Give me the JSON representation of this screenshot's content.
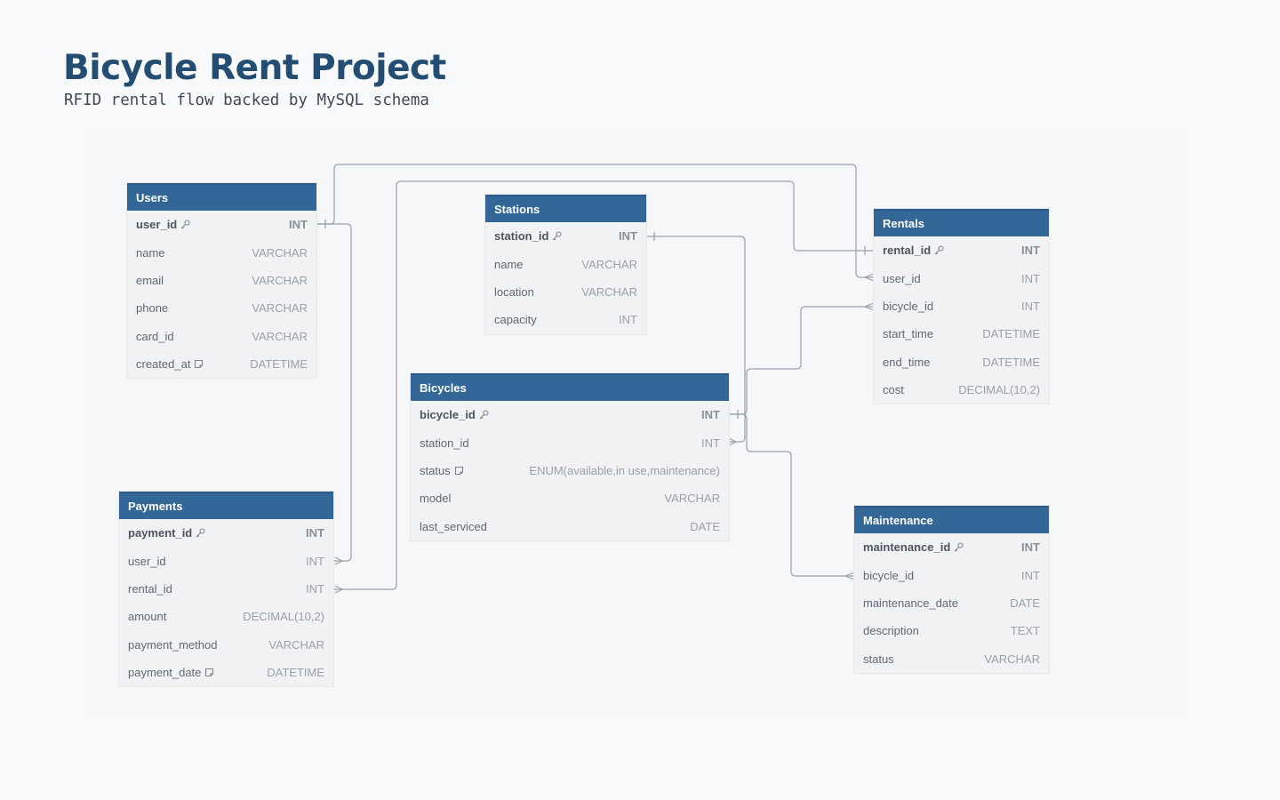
{
  "header": {
    "title": "Bicycle Rent Project",
    "subtitle": "RFID rental flow backed by MySQL schema"
  },
  "colors": {
    "header_bg": "#336798",
    "title": "#234d73",
    "connector": "#9aa1aa"
  },
  "tables": {
    "users": {
      "name": "Users",
      "fields": [
        {
          "name": "user_id",
          "type": "INT",
          "icon": "key-icon"
        },
        {
          "name": "name",
          "type": "VARCHAR"
        },
        {
          "name": "email",
          "type": "VARCHAR"
        },
        {
          "name": "phone",
          "type": "VARCHAR"
        },
        {
          "name": "card_id",
          "type": "VARCHAR"
        },
        {
          "name": "created_at",
          "type": "DATETIME",
          "icon": "note-icon"
        }
      ]
    },
    "stations": {
      "name": "Stations",
      "fields": [
        {
          "name": "station_id",
          "type": "INT",
          "icon": "key-icon"
        },
        {
          "name": "name",
          "type": "VARCHAR"
        },
        {
          "name": "location",
          "type": "VARCHAR"
        },
        {
          "name": "capacity",
          "type": "INT"
        }
      ]
    },
    "rentals": {
      "name": "Rentals",
      "fields": [
        {
          "name": "rental_id",
          "type": "INT",
          "icon": "key-icon"
        },
        {
          "name": "user_id",
          "type": "INT"
        },
        {
          "name": "bicycle_id",
          "type": "INT"
        },
        {
          "name": "start_time",
          "type": "DATETIME"
        },
        {
          "name": "end_time",
          "type": "DATETIME"
        },
        {
          "name": "cost",
          "type": "DECIMAL(10,2)"
        }
      ]
    },
    "bicycles": {
      "name": "Bicycles",
      "fields": [
        {
          "name": "bicycle_id",
          "type": "INT",
          "icon": "key-icon"
        },
        {
          "name": "station_id",
          "type": "INT"
        },
        {
          "name": "status",
          "type": "ENUM(available,in use,maintenance)",
          "icon": "note-icon"
        },
        {
          "name": "model",
          "type": "VARCHAR"
        },
        {
          "name": "last_serviced",
          "type": "DATE"
        }
      ]
    },
    "payments": {
      "name": "Payments",
      "fields": [
        {
          "name": "payment_id",
          "type": "INT",
          "icon": "key-icon"
        },
        {
          "name": "user_id",
          "type": "INT"
        },
        {
          "name": "rental_id",
          "type": "INT"
        },
        {
          "name": "amount",
          "type": "DECIMAL(10,2)"
        },
        {
          "name": "payment_method",
          "type": "VARCHAR"
        },
        {
          "name": "payment_date",
          "type": "DATETIME",
          "icon": "note-icon"
        }
      ]
    },
    "maintenance": {
      "name": "Maintenance",
      "fields": [
        {
          "name": "maintenance_id",
          "type": "INT",
          "icon": "key-icon"
        },
        {
          "name": "bicycle_id",
          "type": "INT"
        },
        {
          "name": "maintenance_date",
          "type": "DATE"
        },
        {
          "name": "description",
          "type": "TEXT"
        },
        {
          "name": "status",
          "type": "VARCHAR"
        }
      ]
    }
  },
  "relationships": [
    {
      "from": "users.user_id",
      "to": "rentals.user_id",
      "from_card": "one",
      "to_card": "many"
    },
    {
      "from": "rentals.rental_id",
      "to": "payments.rental_id",
      "from_card": "one",
      "to_card": "many"
    },
    {
      "from": "users.user_id",
      "to": "payments.user_id",
      "from_card": "one",
      "to_card": "many"
    },
    {
      "from": "stations.station_id",
      "to": "bicycles.station_id",
      "from_card": "one",
      "to_card": "many"
    },
    {
      "from": "bicycles.bicycle_id",
      "to": "rentals.bicycle_id",
      "from_card": "one",
      "to_card": "many"
    },
    {
      "from": "bicycles.bicycle_id",
      "to": "maintenance.bicycle_id",
      "from_card": "one",
      "to_card": "many"
    }
  ]
}
